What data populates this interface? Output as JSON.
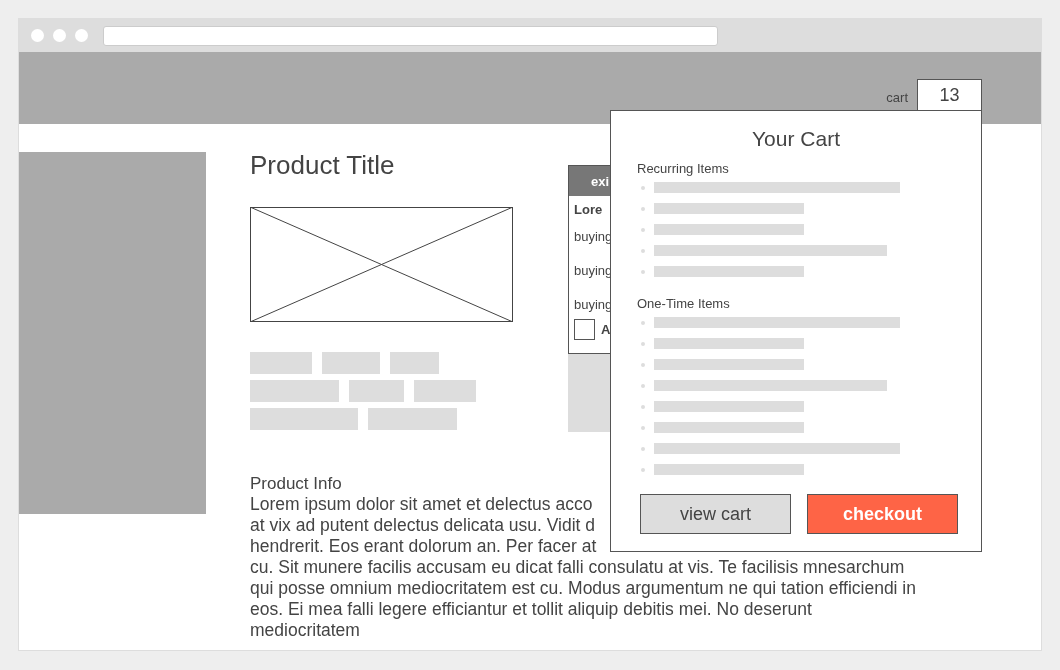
{
  "header": {
    "cart_label": "cart",
    "cart_count": "13"
  },
  "product": {
    "title": "Product Title",
    "card": {
      "header": "exi",
      "heading": "Lore",
      "options": [
        "buying",
        "buying",
        "buying"
      ],
      "checkbox": {
        "label": "A",
        "checked": false
      }
    },
    "info_title": "Product Info",
    "info_lines": [
      "Lorem ipsum dolor sit amet et delectus acco",
      "at vix ad putent delectus delicata usu. Vidit d",
      "hendrerit. Eos erant dolorum an. Per facer at",
      "cu. Sit munere facilis accusam eu dicat falli consulatu at vis. Te facilisis mnesarchum",
      "qui posse omnium mediocritatem est cu. Modus argumentum ne qui tation efficiendi in",
      "eos. Ei mea falli legere efficiantur et tollit aliquip debitis mei. No deserunt",
      "mediocritatem"
    ]
  },
  "cart_popup": {
    "title": "Your Cart",
    "sections": [
      {
        "label": "Recurring Items",
        "items": [
          {
            "kind": "long"
          },
          {
            "kind": "short"
          },
          {
            "kind": "short"
          },
          {
            "kind": "medium"
          },
          {
            "kind": "short"
          }
        ]
      },
      {
        "label": "One-Time Items",
        "items": [
          {
            "kind": "long"
          },
          {
            "kind": "short"
          },
          {
            "kind": "short"
          },
          {
            "kind": "medium"
          },
          {
            "kind": "short"
          },
          {
            "kind": "short"
          },
          {
            "kind": "long"
          },
          {
            "kind": "short"
          }
        ]
      }
    ],
    "buttons": [
      {
        "label": "view cart",
        "kind": "secondary"
      },
      {
        "label": "checkout",
        "kind": "primary"
      }
    ]
  }
}
